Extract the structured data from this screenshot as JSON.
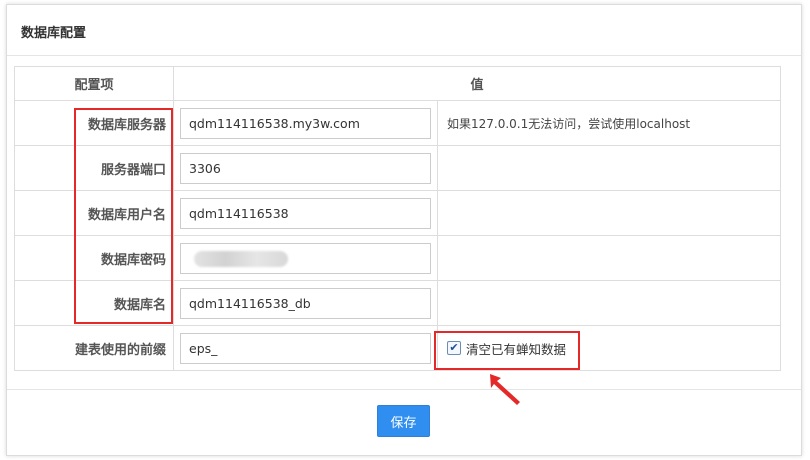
{
  "panel": {
    "title": "数据库配置"
  },
  "table": {
    "headers": {
      "item": "配置项",
      "value": "值"
    },
    "rows": {
      "server": {
        "label": "数据库服务器",
        "value": "qdm114116538.my3w.com",
        "note": "如果127.0.0.1无法访问，尝试使用localhost"
      },
      "port": {
        "label": "服务器端口",
        "value": "3306"
      },
      "user": {
        "label": "数据库用户名",
        "value": "qdm114116538"
      },
      "password": {
        "label": "数据库密码",
        "value": ""
      },
      "dbname": {
        "label": "数据库名",
        "value": "qdm114116538_db"
      },
      "prefix": {
        "label": "建表使用的前缀",
        "value": "eps_"
      }
    },
    "clear_checkbox": {
      "label": "清空已有蝉知数据",
      "checked": true
    }
  },
  "footer": {
    "save_label": "保存"
  },
  "annotation": {
    "color": "#e32929"
  }
}
